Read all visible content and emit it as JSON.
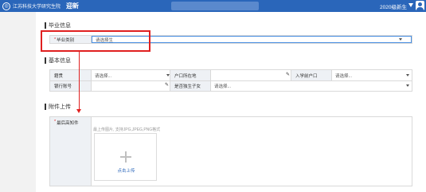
{
  "header": {
    "logo_symbol": "◎",
    "school_name": "江苏科技大学研究生院",
    "brand": "迎新",
    "year_select": "2020级新生"
  },
  "graduate": {
    "title": "毕业信息",
    "field_label": "毕业类别",
    "field_required": "*",
    "field_value": "请选择生"
  },
  "basic": {
    "title": "基本信息",
    "rows": [
      [
        {
          "label": "籍贯",
          "value": "请选择..."
        },
        {
          "label": "户口所在地",
          "value": ""
        },
        {
          "label": "入学前户口",
          "value": "请选择..."
        }
      ],
      [
        {
          "label": "银行账号",
          "value": ""
        },
        {
          "label": "是否独生子女",
          "value": "请选择..."
        }
      ]
    ]
  },
  "attachments": {
    "title": "附件上传",
    "field_label": "最后高知件",
    "field_required": "*",
    "hint": "最上传图片, 支持JPG,JPEG,PNG格式",
    "upload_button": "点击上传"
  },
  "icons": [
    "school-logo-icon",
    "chevron-down-icon",
    "user-avatar-icon",
    "pencil-icon",
    "plus-icon"
  ],
  "colors": {
    "header_bg": "#2a66ba",
    "annotation": "#e02020",
    "accent": "#2a66ba"
  }
}
